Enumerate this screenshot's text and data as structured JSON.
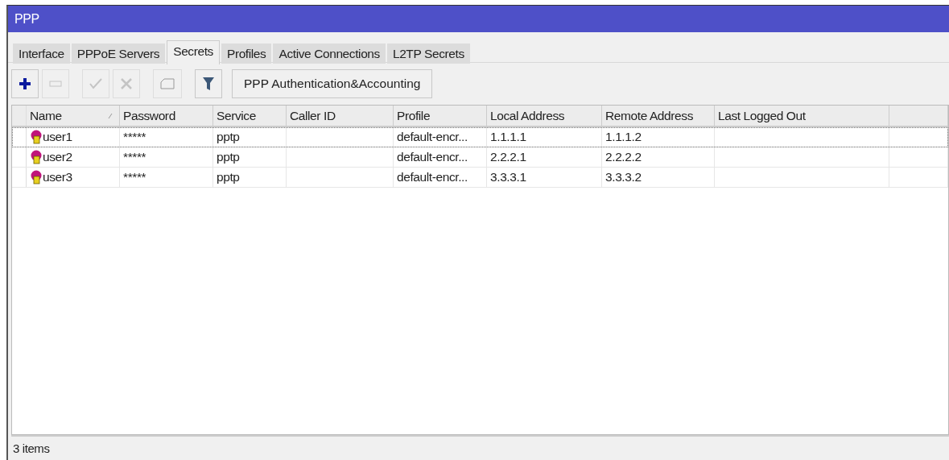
{
  "window": {
    "title": "PPP"
  },
  "tabs": [
    {
      "label": "Interface",
      "selected": false
    },
    {
      "label": "PPPoE Servers",
      "selected": false
    },
    {
      "label": "Secrets",
      "selected": true
    },
    {
      "label": "Profiles",
      "selected": false
    },
    {
      "label": "Active Connections",
      "selected": false
    },
    {
      "label": "L2TP Secrets",
      "selected": false
    }
  ],
  "toolbar": [
    {
      "kind": "add",
      "disabled": false
    },
    {
      "kind": "remove",
      "disabled": true
    },
    {
      "kind": "enable",
      "disabled": true
    },
    {
      "kind": "disable",
      "disabled": true
    },
    {
      "kind": "comment",
      "disabled": true
    },
    {
      "kind": "filter",
      "disabled": false
    },
    {
      "kind": "text",
      "label": "PPP Authentication&Accounting",
      "disabled": false
    }
  ],
  "table": {
    "columns": [
      {
        "label": "Name",
        "sorted": true
      },
      {
        "label": "Password",
        "sorted": false
      },
      {
        "label": "Service",
        "sorted": false
      },
      {
        "label": "Caller ID",
        "sorted": false
      },
      {
        "label": "Profile",
        "sorted": false
      },
      {
        "label": "Local Address",
        "sorted": false
      },
      {
        "label": "Remote Address",
        "sorted": false
      },
      {
        "label": "Last Logged Out",
        "sorted": false
      }
    ],
    "rows": [
      {
        "selected": true,
        "cells": [
          "user1",
          "*****",
          "pptp",
          "",
          "default-encr...",
          "1.1.1.1",
          "1.1.1.2",
          ""
        ]
      },
      {
        "selected": false,
        "cells": [
          "user2",
          "*****",
          "pptp",
          "",
          "default-encr...",
          "2.2.2.1",
          "2.2.2.2",
          ""
        ]
      },
      {
        "selected": false,
        "cells": [
          "user3",
          "*****",
          "pptp",
          "",
          "default-encr...",
          "3.3.3.1",
          "3.3.3.2",
          ""
        ]
      }
    ]
  },
  "status_bar": "3 items"
}
